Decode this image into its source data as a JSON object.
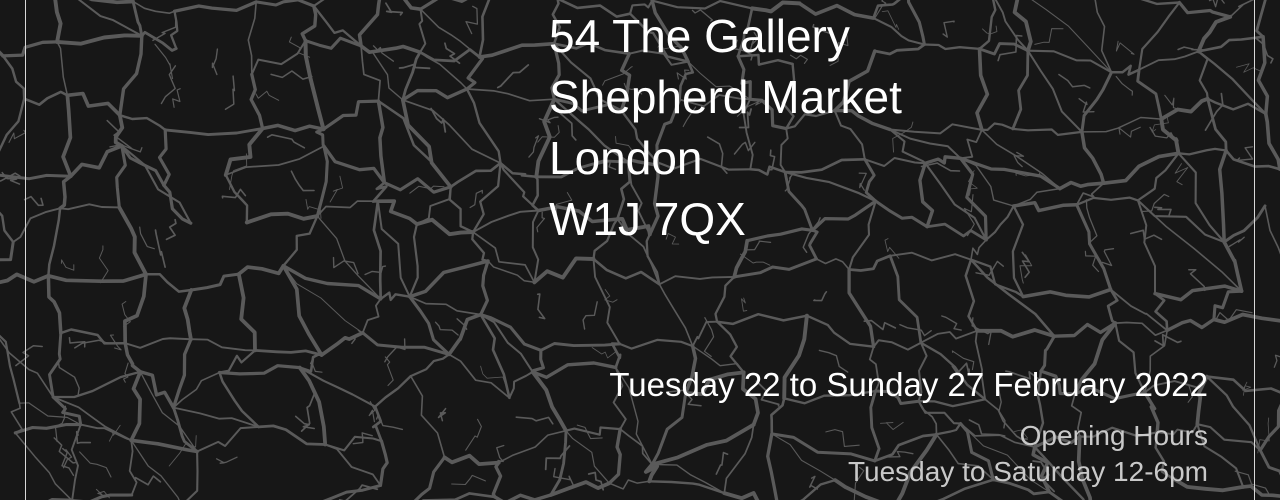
{
  "address": {
    "line1": "54 The Gallery",
    "line2": "Shepherd Market",
    "line3": "London",
    "line4": "W1J 7QX"
  },
  "dates": "Tuesday 22 to Sunday 27 February 2022",
  "hours": {
    "heading": "Opening Hours",
    "weekdays": "Tuesday to Saturday 12-6pm"
  },
  "colors": {
    "background": "#171717",
    "crack": "#5a5a5a",
    "text": "#ffffff",
    "muted_text": "#c9c9c9"
  }
}
